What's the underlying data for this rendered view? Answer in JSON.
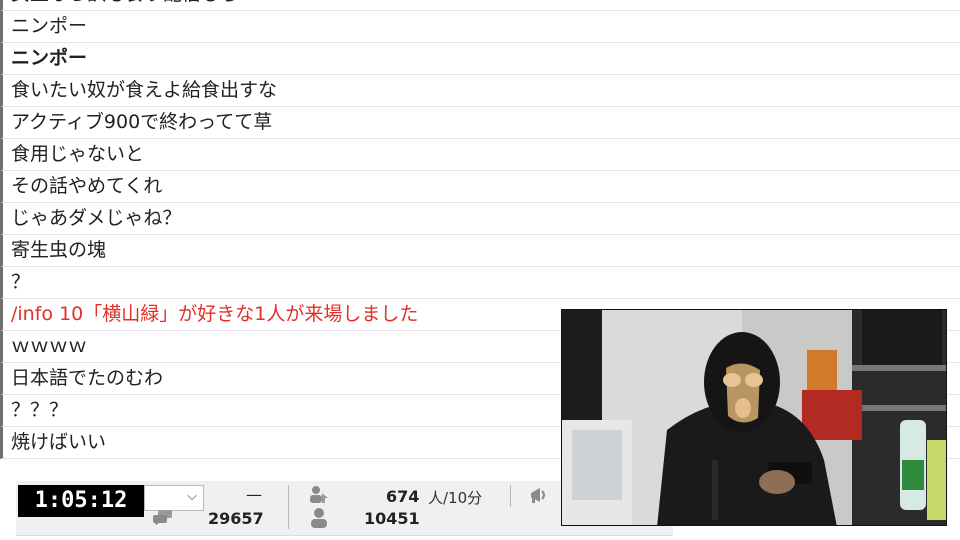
{
  "comments": [
    {
      "text": "女王なら訳も食う配信しろ",
      "style": "normal"
    },
    {
      "text": "ニンポー",
      "style": "normal"
    },
    {
      "text": "ニンポー",
      "style": "bold"
    },
    {
      "text": "食いたい奴が食えよ給食出すな",
      "style": "normal"
    },
    {
      "text": "アクティブ900で終わってて草",
      "style": "normal"
    },
    {
      "text": "食用じゃないと",
      "style": "normal"
    },
    {
      "text": "その話やめてくれ",
      "style": "normal"
    },
    {
      "text": "じゃあダメじゃね？",
      "style": "normal"
    },
    {
      "text": "寄生虫の塊",
      "style": "normal"
    },
    {
      "text": "？",
      "style": "normal"
    },
    {
      "text": "/info 10「横山緑」が好きな1人が来場しました",
      "style": "info"
    },
    {
      "text": "ｗｗｗｗ",
      "style": "normal"
    },
    {
      "text": "日本語でたのむわ",
      "style": "normal"
    },
    {
      "text": "？？？",
      "style": "normal"
    },
    {
      "text": "焼けばいい",
      "style": "normal"
    }
  ],
  "status": {
    "elapsed_time": "1:05:12",
    "dash": "—",
    "comment_count": "29657",
    "active_count": "674",
    "active_unit": "人/10分",
    "visitor_count": "10451"
  },
  "colors": {
    "info_text": "#e0302a",
    "timer_bg": "#000000",
    "timer_text": "#ffffff"
  },
  "icons": {
    "comment": "comment-bubbles-icon",
    "active": "active-users-icon",
    "visitors": "visitor-icon",
    "ad": "megaphone-icon"
  }
}
